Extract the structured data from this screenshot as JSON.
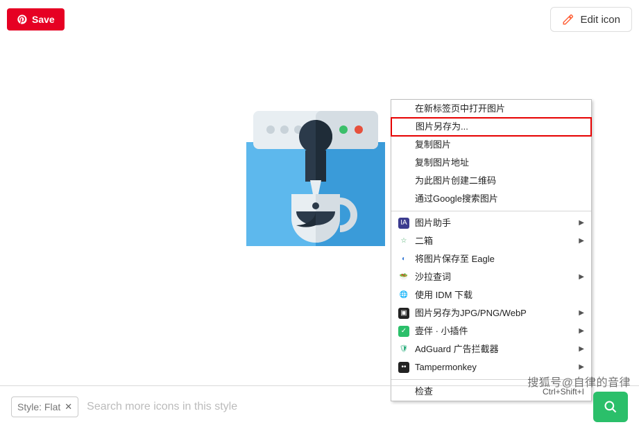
{
  "topbar": {
    "save_label": "Save",
    "edit_label": "Edit icon"
  },
  "context_menu": {
    "basic": [
      "在新标签页中打开图片",
      "图片另存为...",
      "复制图片",
      "复制图片地址",
      "为此图片创建二维码",
      "通过Google搜索图片"
    ],
    "extensions": [
      {
        "label": "图片助手",
        "icon_bg": "#3b3b8f",
        "icon_text": "IA",
        "icon_color": "#fff"
      },
      {
        "label": "二箱",
        "icon_bg": "#fff",
        "icon_text": "☆",
        "icon_color": "#4a6"
      },
      {
        "label": "将图片保存至 Eagle",
        "icon_bg": "#fff",
        "icon_text": "◐",
        "icon_color": "#3a7bd5"
      },
      {
        "label": "沙拉查词",
        "icon_bg": "#fff",
        "icon_text": "🥗",
        "icon_color": ""
      },
      {
        "label": "使用 IDM 下载",
        "icon_bg": "#fff",
        "icon_text": "🌐",
        "icon_color": ""
      },
      {
        "label": "图片另存为JPG/PNG/WebP",
        "icon_bg": "#222",
        "icon_text": "▣",
        "icon_color": "#fff"
      },
      {
        "label": "壹伴 · 小插件",
        "icon_bg": "#2bbf6a",
        "icon_text": "✓",
        "icon_color": "#fff"
      },
      {
        "label": "AdGuard 广告拦截器",
        "icon_bg": "#fff",
        "icon_text": "🛡",
        "icon_color": "#2a7"
      },
      {
        "label": "Tampermonkey",
        "icon_bg": "#222",
        "icon_text": "••",
        "icon_color": "#fff"
      }
    ],
    "highlight_index": 1,
    "inspect_label": "检查",
    "inspect_shortcut": "Ctrl+Shift+I"
  },
  "bottom": {
    "chip_label": "Style: Flat",
    "search_placeholder": "Search more icons in this style"
  },
  "watermark": "搜狐号@自律的音律"
}
